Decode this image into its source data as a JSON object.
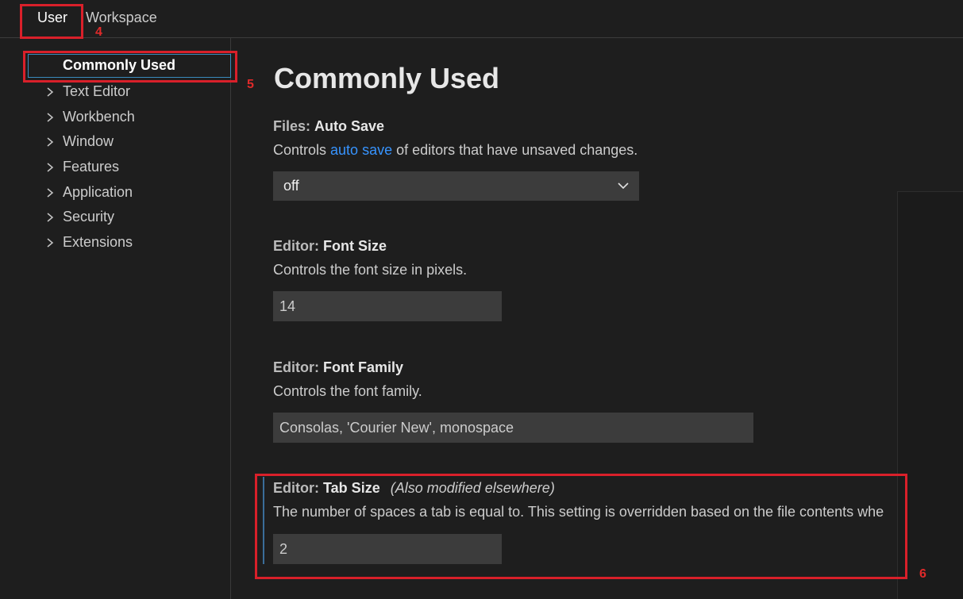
{
  "scope_tabs": {
    "user": "User",
    "workspace": "Workspace"
  },
  "toc": {
    "items": [
      {
        "label": "Commonly Used",
        "active": true
      },
      {
        "label": "Text Editor"
      },
      {
        "label": "Workbench"
      },
      {
        "label": "Window"
      },
      {
        "label": "Features"
      },
      {
        "label": "Application"
      },
      {
        "label": "Security"
      },
      {
        "label": "Extensions"
      }
    ]
  },
  "main": {
    "title": "Commonly Used",
    "settings": [
      {
        "category": "Files:",
        "name": "Auto Save",
        "desc_prefix": "Controls ",
        "desc_link": "auto save",
        "desc_suffix": " of editors that have unsaved changes.",
        "control": "select",
        "value": "off"
      },
      {
        "category": "Editor:",
        "name": "Font Size",
        "desc": "Controls the font size in pixels.",
        "control": "input",
        "value": "14"
      },
      {
        "category": "Editor:",
        "name": "Font Family",
        "desc": "Controls the font family.",
        "control": "input",
        "value": "Consolas, 'Courier New', monospace"
      },
      {
        "category": "Editor:",
        "name": "Tab Size",
        "modified_note": "(Also modified elsewhere)",
        "desc": "The number of spaces a tab is equal to. This setting is overridden based on the file contents whe",
        "control": "input",
        "value": "2"
      }
    ]
  },
  "annotations": {
    "n4": "4",
    "n5": "5",
    "n6": "6",
    "color": "#d9202a"
  },
  "colors": {
    "background": "#1e1e1e",
    "input_bg": "#3c3c3c",
    "link": "#3794ff",
    "focus": "#3a8bbd"
  }
}
